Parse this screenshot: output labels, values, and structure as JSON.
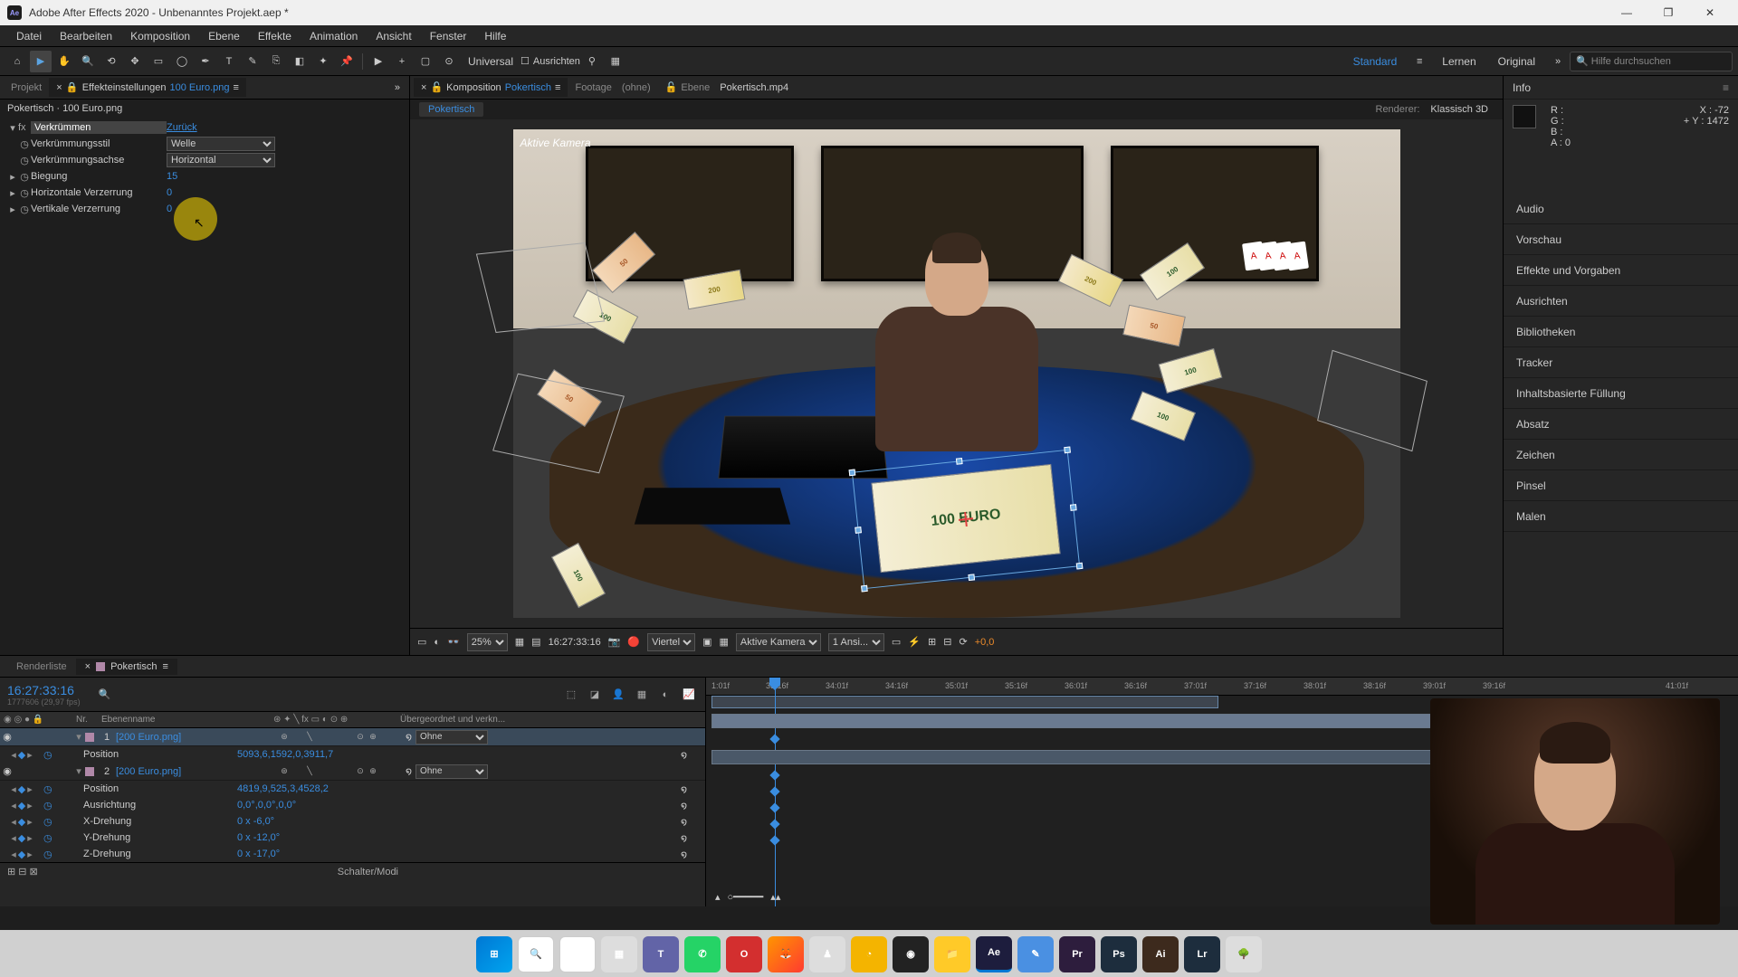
{
  "title": "Adobe After Effects 2020 - Unbenanntes Projekt.aep *",
  "menu": [
    "Datei",
    "Bearbeiten",
    "Komposition",
    "Ebene",
    "Effekte",
    "Animation",
    "Ansicht",
    "Fenster",
    "Hilfe"
  ],
  "toolbar": {
    "universal": "Universal",
    "ausrichten": "Ausrichten",
    "workspaces": [
      "Standard",
      "Lernen",
      "Original"
    ],
    "active_ws": "Standard",
    "search_ph": "Hilfe durchsuchen"
  },
  "left_tabs": {
    "projekt": "Projekt",
    "fx": "Effekteinstellungen",
    "fx_file": "100 Euro.png"
  },
  "fx": {
    "breadcrumb": "Pokertisch · 100 Euro.png",
    "name": "Verkrümmen",
    "reset": "Zurück",
    "rows": [
      {
        "label": "Verkrümmungsstil",
        "value": "Welle",
        "type": "select"
      },
      {
        "label": "Verkrümmungsachse",
        "value": "Horizontal",
        "type": "select"
      },
      {
        "label": "Biegung",
        "value": "15",
        "type": "num"
      },
      {
        "label": "Horizontale Verzerrung",
        "value": "0",
        "type": "num"
      },
      {
        "label": "Vertikale Verzerrung",
        "value": "0",
        "type": "num"
      }
    ]
  },
  "center_tabs": {
    "comp": "Komposition",
    "comp_name": "Pokertisch",
    "footage": "Footage",
    "footage_val": "(ohne)",
    "layer": "Ebene",
    "layer_val": "Pokertisch.mp4"
  },
  "viewer": {
    "breadcrumb": "Pokertisch",
    "renderer_lbl": "Renderer:",
    "renderer": "Klassisch 3D",
    "camera": "Aktive Kamera",
    "zoom": "25%",
    "timecode": "16:27:33:16",
    "res": "Viertel",
    "view": "Aktive Kamera",
    "views": "1 Ansi...",
    "exposure": "+0,0"
  },
  "info": {
    "title": "Info",
    "R": "R :",
    "G": "G :",
    "B": "B :",
    "A": "A :",
    "Aval": "0",
    "X": "X :",
    "Xval": "-72",
    "Y": "Y :",
    "Yval": "1472",
    "plus": "+"
  },
  "right_panels": [
    "Audio",
    "Vorschau",
    "Effekte und Vorgaben",
    "Ausrichten",
    "Bibliotheken",
    "Tracker",
    "Inhaltsbasierte Füllung",
    "Absatz",
    "Zeichen",
    "Pinsel",
    "Malen"
  ],
  "tl": {
    "render": "Renderliste",
    "comp": "Pokertisch",
    "time": "16:27:33:16",
    "sub": "1777606 (29,97 fps)",
    "col_nr": "Nr.",
    "col_name": "Ebenenname",
    "col_parent": "Übergeordnet und verkn...",
    "parent_none": "Ohne",
    "layers": [
      {
        "nr": "1",
        "name": "[200 Euro.png]",
        "sel": true,
        "pos": "5093,6,1592,0,3911,7"
      },
      {
        "nr": "2",
        "name": "[200 Euro.png]",
        "sel": false,
        "pos": "4819,9,525,3,4528,2"
      }
    ],
    "props": [
      {
        "name": "Position",
        "val": "5093,6,1592,0,3911,7"
      },
      {
        "name": "Position",
        "val": "4819,9,525,3,4528,2"
      },
      {
        "name": "Ausrichtung",
        "val": "0,0°,0,0°,0,0°"
      },
      {
        "name": "X-Drehung",
        "val": "0 x -6,0°"
      },
      {
        "name": "Y-Drehung",
        "val": "0 x -12,0°"
      },
      {
        "name": "Z-Drehung",
        "val": "0 x -17,0°"
      }
    ],
    "ruler": [
      "1:01f",
      "33:16f",
      "34:01f",
      "34:16f",
      "35:01f",
      "35:16f",
      "36:01f",
      "36:16f",
      "37:01f",
      "37:16f",
      "38:01f",
      "38:16f",
      "39:01f",
      "39:16f",
      "41:01f"
    ],
    "footer": "Schalter/Modi"
  },
  "taskbar": [
    "Win",
    "Search",
    "Task",
    "Widgets",
    "Teams",
    "WA",
    "O",
    "FF",
    "App",
    "App",
    "Clock",
    "Files",
    "Ae",
    "Ed",
    "Pr",
    "Ps",
    "Ai",
    "Lr",
    "App"
  ]
}
